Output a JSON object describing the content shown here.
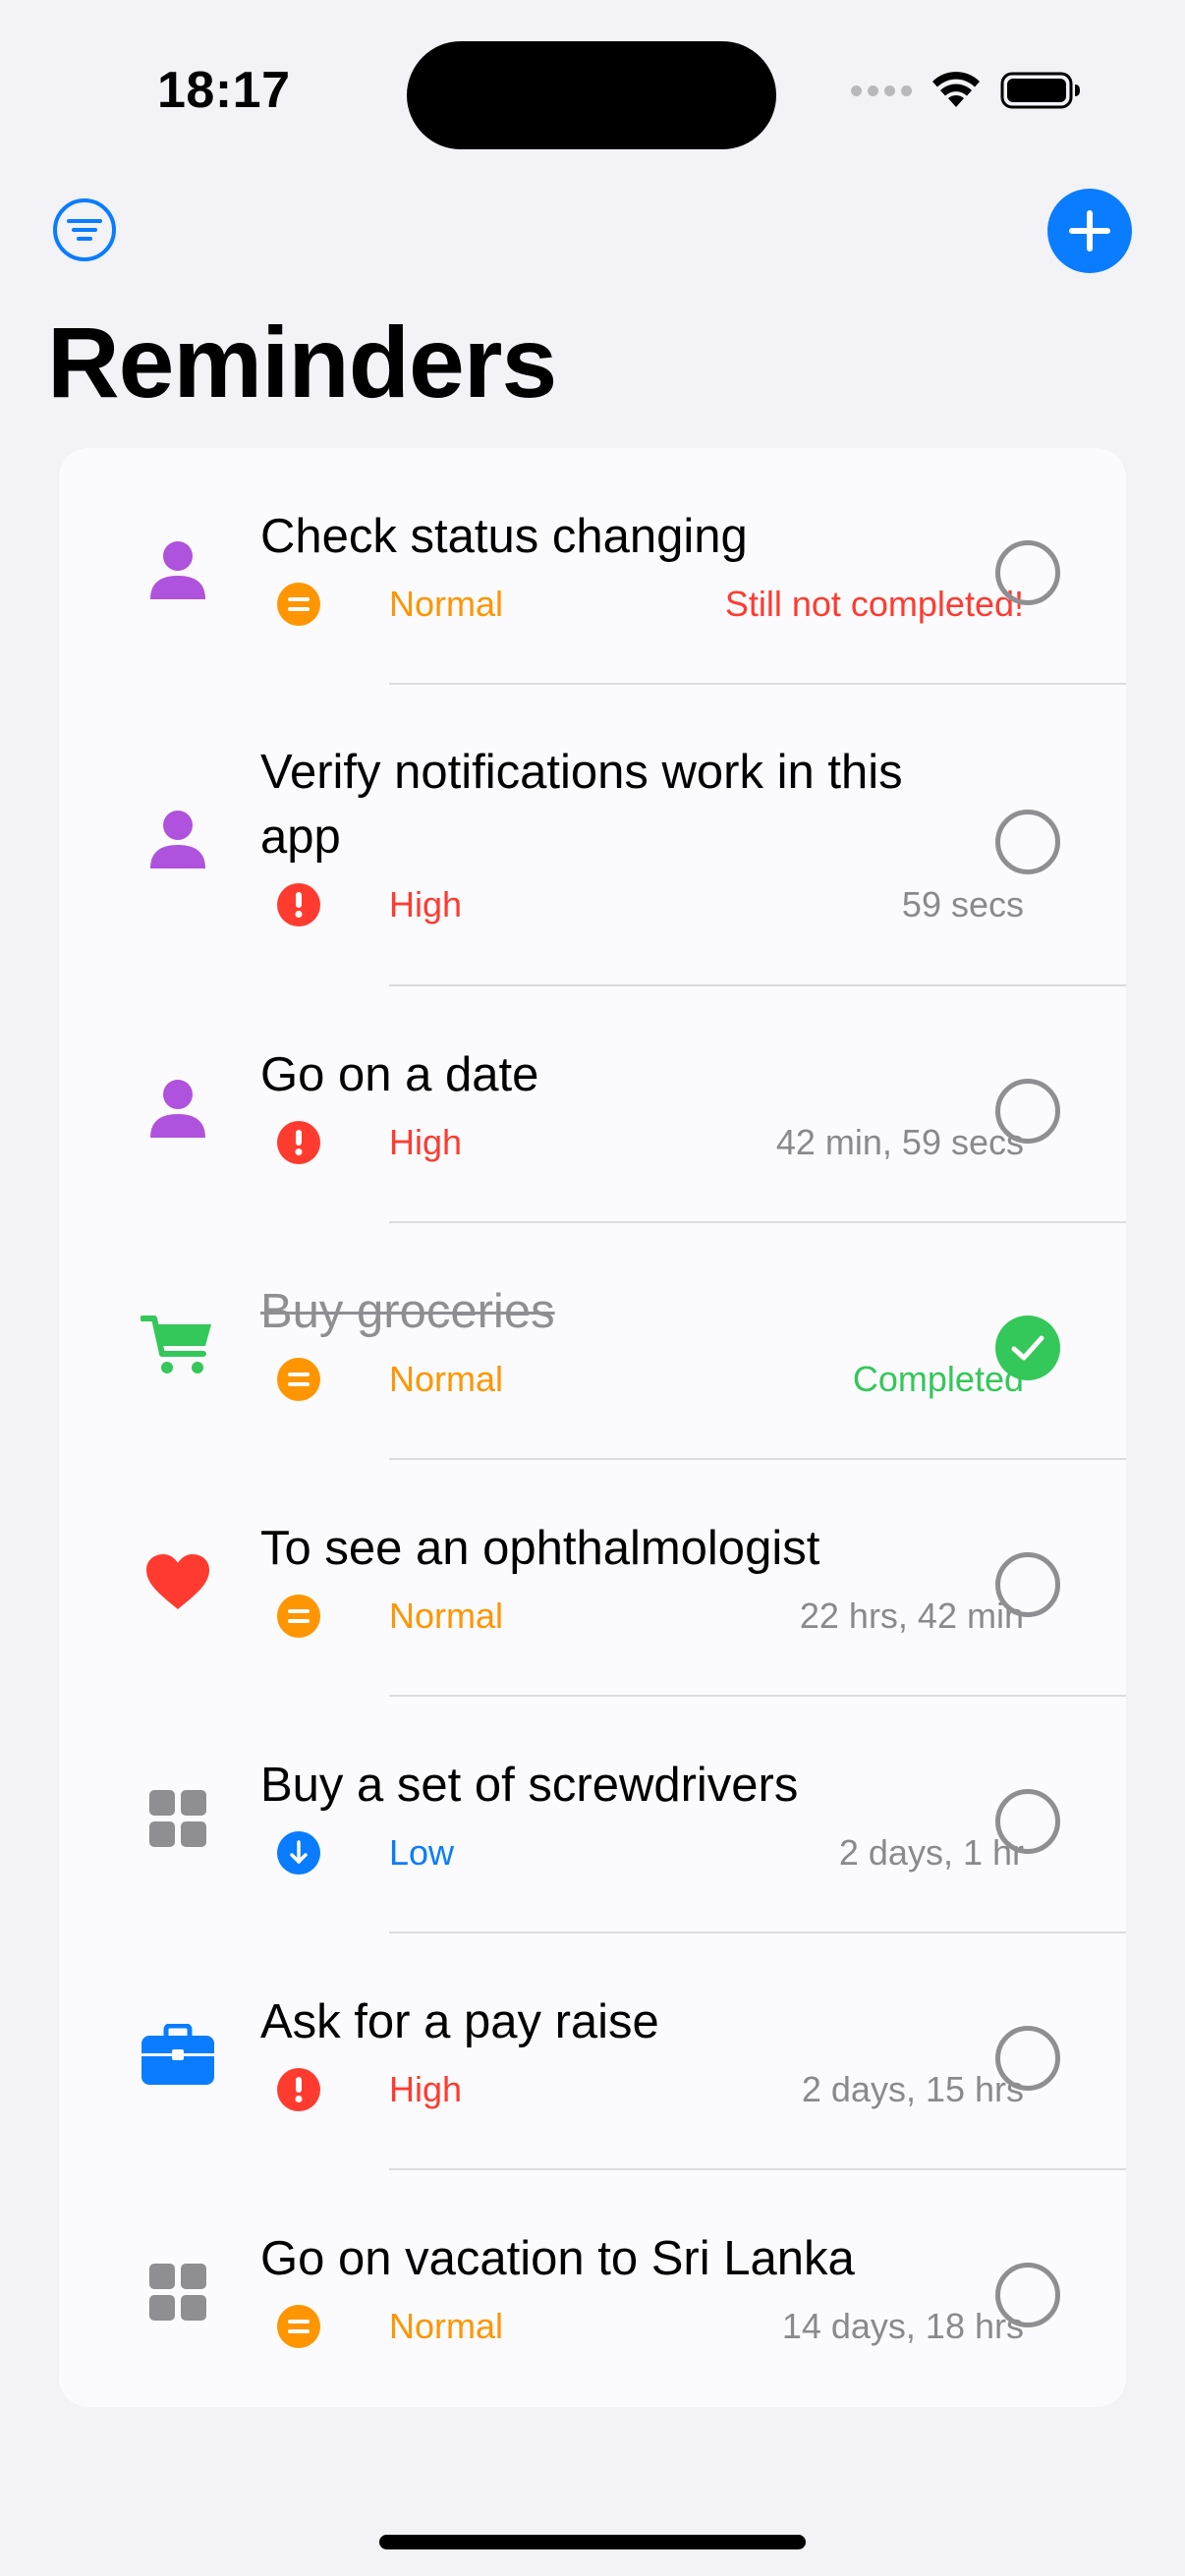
{
  "status_bar": {
    "time": "18:17",
    "icons": [
      "signal-dots",
      "wifi-icon",
      "battery-icon"
    ]
  },
  "header": {
    "title": "Reminders",
    "filter_icon": "filter-icon",
    "add_icon": "plus-icon"
  },
  "colors": {
    "accent": "#0a7cff",
    "normal": "#ff9500",
    "high": "#ff3b30",
    "low": "#0a7cff",
    "completed": "#34c759",
    "personal": "#af52de",
    "shopping": "#34c759",
    "health": "#ff3b30",
    "other": "#8e8e93",
    "work": "#0a7cff"
  },
  "reminders": [
    {
      "title": "Check status changing",
      "priority": "Normal",
      "time": "Still not completed!",
      "category_icon": "person-icon",
      "completed": false
    },
    {
      "title": "Verify notifications work in this app",
      "priority": "High",
      "time": "59 secs",
      "category_icon": "person-icon",
      "completed": false
    },
    {
      "title": "Go on a date",
      "priority": "High",
      "time": "42 min, 59 secs",
      "category_icon": "person-icon",
      "completed": false
    },
    {
      "title": "Buy groceries",
      "priority": "Normal",
      "time": "Completed",
      "category_icon": "cart-icon",
      "completed": true
    },
    {
      "title": "To see an ophthalmologist",
      "priority": "Normal",
      "time": "22 hrs, 42 min",
      "category_icon": "heart-icon",
      "completed": false
    },
    {
      "title": "Buy a set of screwdrivers",
      "priority": "Low",
      "time": "2 days, 1 hr",
      "category_icon": "grid-icon",
      "completed": false
    },
    {
      "title": "Ask for a pay raise",
      "priority": "High",
      "time": "2 days, 15 hrs",
      "category_icon": "briefcase-icon",
      "completed": false
    },
    {
      "title": "Go on vacation to Sri Lanka",
      "priority": "Normal",
      "time": "14 days, 18 hrs",
      "category_icon": "grid-icon",
      "completed": false
    }
  ]
}
